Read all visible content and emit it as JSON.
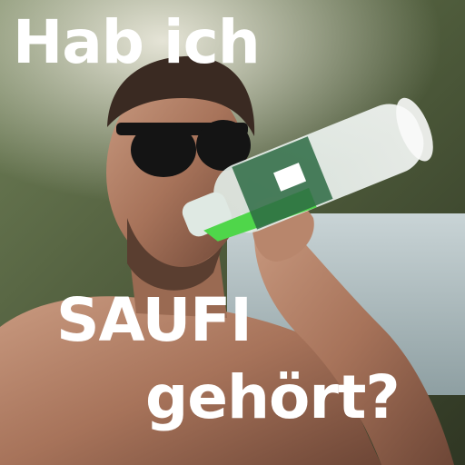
{
  "meme": {
    "caption_line_1": "Hab ich",
    "caption_line_2": "SAUFI",
    "caption_line_3": "gehört?"
  },
  "colors": {
    "caption_text": "#ffffff",
    "background": "#ffffff",
    "drink_green": "#4fd64a",
    "water": "#9fb2b8",
    "skin": "#b08068",
    "sunglasses": "#141414"
  }
}
